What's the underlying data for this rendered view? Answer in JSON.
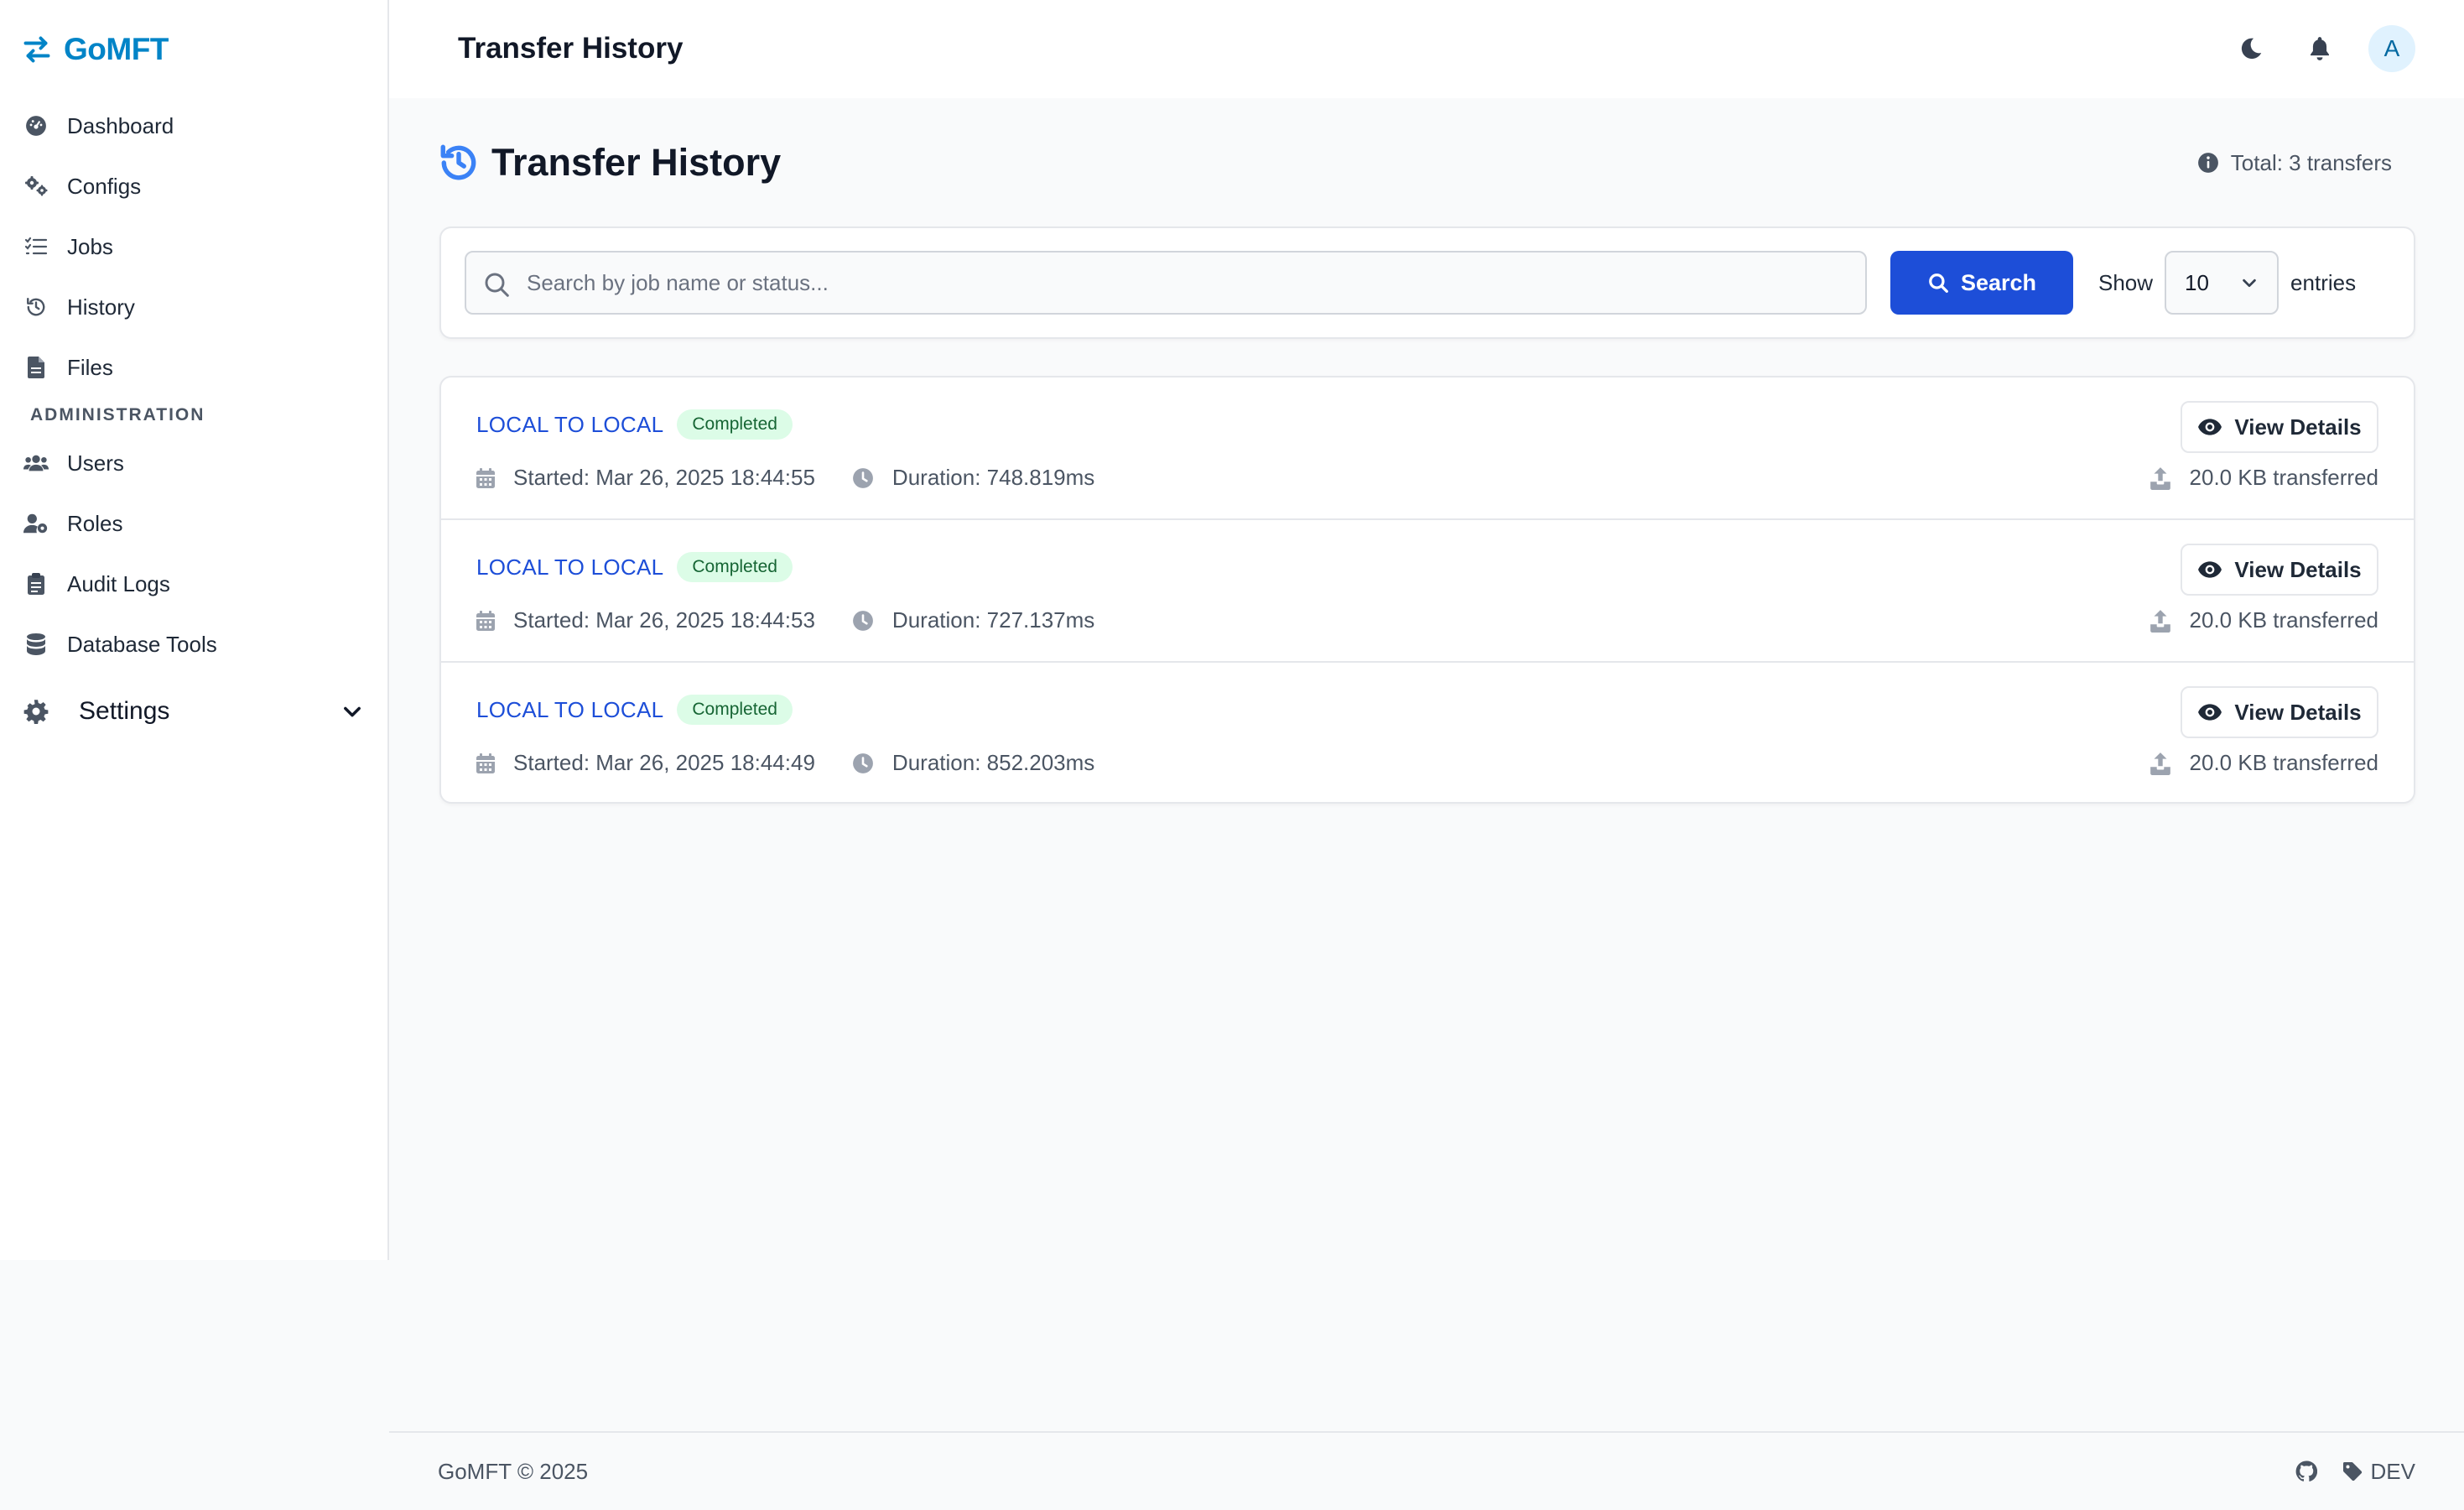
{
  "brand": {
    "name": "GoMFT",
    "color": "#0284c7"
  },
  "sidebar": {
    "items": [
      {
        "label": "Dashboard",
        "icon": "dashboard-icon"
      },
      {
        "label": "Configs",
        "icon": "gears-icon"
      },
      {
        "label": "Jobs",
        "icon": "list-check-icon"
      },
      {
        "label": "History",
        "icon": "history-icon"
      },
      {
        "label": "Files",
        "icon": "file-icon"
      }
    ],
    "section_title": "ADMINISTRATION",
    "admin_items": [
      {
        "label": "Users",
        "icon": "users-icon"
      },
      {
        "label": "Roles",
        "icon": "user-gear-icon"
      },
      {
        "label": "Audit Logs",
        "icon": "clipboard-icon"
      },
      {
        "label": "Database Tools",
        "icon": "database-icon"
      }
    ],
    "settings": {
      "label": "Settings",
      "icon": "gear-icon"
    }
  },
  "topbar": {
    "title": "Transfer History",
    "avatar_initial": "A"
  },
  "page": {
    "title": "Transfer History",
    "total": "Total: 3 transfers"
  },
  "search": {
    "placeholder": "Search by job name or status...",
    "button_label": "Search",
    "show_label": "Show",
    "entries_value": "10",
    "entries_label": "entries"
  },
  "transfers": [
    {
      "name": "LOCAL TO LOCAL",
      "status": "Completed",
      "started": "Started: Mar 26, 2025 18:44:55",
      "duration": "Duration: 748.819ms",
      "size": "20.0 KB transferred",
      "details_label": "View Details"
    },
    {
      "name": "LOCAL TO LOCAL",
      "status": "Completed",
      "started": "Started: Mar 26, 2025 18:44:53",
      "duration": "Duration: 727.137ms",
      "size": "20.0 KB transferred",
      "details_label": "View Details"
    },
    {
      "name": "LOCAL TO LOCAL",
      "status": "Completed",
      "started": "Started: Mar 26, 2025 18:44:49",
      "duration": "Duration: 852.203ms",
      "size": "20.0 KB transferred",
      "details_label": "View Details"
    }
  ],
  "footer": {
    "copyright": "GoMFT © 2025",
    "version": "DEV"
  },
  "colors": {
    "accent": "#1d4ed8",
    "link": "#1d4ed8",
    "success_bg": "#dcfce7",
    "success_text": "#166534"
  }
}
